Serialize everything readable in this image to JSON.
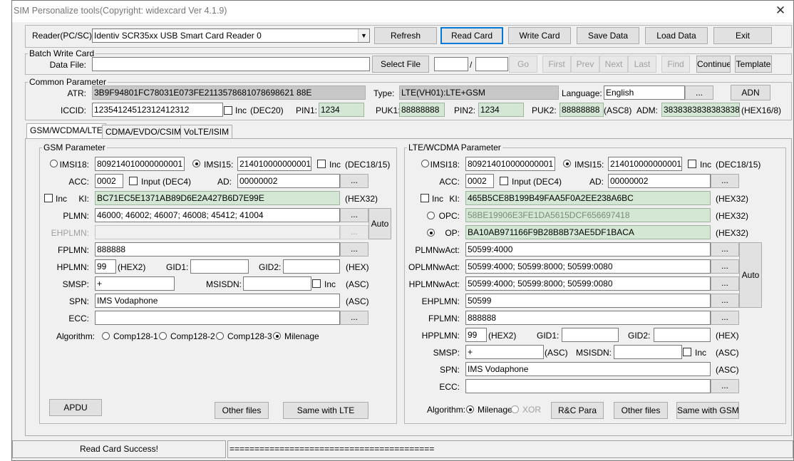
{
  "window": {
    "title": "SIM Personalize tools(Copyright: widexcard Ver 4.1.9)"
  },
  "reader": {
    "label": "Reader(PC/SC):",
    "value": "Identiv SCR35xx USB Smart Card Reader 0"
  },
  "toolbar": {
    "refresh": "Refresh",
    "read_card": "Read Card",
    "write_card": "Write Card",
    "save_data": "Save Data",
    "load_data": "Load Data",
    "exit": "Exit"
  },
  "batch": {
    "title": "Batch Write Card",
    "data_file_label": "Data File:",
    "data_file_value": "",
    "select_file": "Select File",
    "slash": "/",
    "go": "Go",
    "first": "First",
    "prev": "Prev",
    "next": "Next",
    "last": "Last",
    "find": "Find",
    "continue": "Continue",
    "template": "Template"
  },
  "common": {
    "title": "Common Parameter",
    "atr_label": "ATR:",
    "atr_value": "3B9F94801FC78031E073FE2113578681078698621 88E",
    "type_label": "Type:",
    "type_value": "LTE(VH01):LTE+GSM",
    "language_label": "Language:",
    "language_value": "English",
    "language_btn": "...",
    "adn_btn": "ADN",
    "iccid_label": "ICCID:",
    "iccid_value": "12354124512312412312",
    "inc_label": "Inc",
    "dec20": "(DEC20)",
    "pin1_label": "PIN1:",
    "pin1_value": "1234",
    "puk1_label": "PUK1:",
    "puk1_value": "88888888",
    "pin2_label": "PIN2:",
    "pin2_value": "1234",
    "puk2_label": "PUK2:",
    "puk2_value": "88888888",
    "asc8": "(ASC8)",
    "adm_label": "ADM:",
    "adm_value": "3838383838383838",
    "hex16_8": "(HEX16/8)"
  },
  "tabs": [
    "GSM/WCDMA/LTE",
    "CDMA/EVDO/CSIM",
    "VoLTE/ISIM"
  ],
  "gsm": {
    "title": "GSM Parameter",
    "imsi18_label": "IMSI18:",
    "imsi18_value": "809214010000000001",
    "imsi15_label": "IMSI15:",
    "imsi15_value": "214010000000001",
    "inc_label": "Inc",
    "dec18_15": "(DEC18/15)",
    "acc_label": "ACC:",
    "acc_value": "0002",
    "input_dec4": "Input (DEC4)",
    "ad_label": "AD:",
    "ad_value": "00000002",
    "ad_btn": "...",
    "ki_label": "KI:",
    "ki_value": "BC71EC5E1371AB89D6E2A427B6D7E99E",
    "hex32": "(HEX32)",
    "plmn_label": "PLMN:",
    "plmn_value": "46000; 46002; 46007; 46008; 45412; 41004",
    "ehplmn_label": "EHPLMN:",
    "ehplmn_value": "",
    "auto_btn": "Auto",
    "fplmn_label": "FPLMN:",
    "fplmn_value": "888888",
    "hplmn_label": "HPLMN:",
    "hplmn_value": "99",
    "hex2": "(HEX2)",
    "gid1_label": "GID1:",
    "gid1_value": "",
    "gid2_label": "GID2:",
    "gid2_value": "",
    "hex": "(HEX)",
    "smsp_label": "SMSP:",
    "smsp_value": "+",
    "msisdn_label": "MSISDN:",
    "msisdn_value": "",
    "asc": "(ASC)",
    "spn_label": "SPN:",
    "spn_value": "IMS Vodaphone",
    "ecc_label": "ECC:",
    "ecc_value": "",
    "algorithm_label": "Algorithm:",
    "comp128_1": "Comp128-1",
    "comp128_2": "Comp128-2",
    "comp128_3": "Comp128-3",
    "milenage": "Milenage",
    "apdu_btn": "APDU",
    "other_files_btn": "Other files",
    "same_lte_btn": "Same with LTE"
  },
  "lte": {
    "title": "LTE/WCDMA Parameter",
    "imsi18_label": "IMSI18:",
    "imsi18_value": "809214010000000001",
    "imsi15_label": "IMSI15:",
    "imsi15_value": "214010000000001",
    "inc_label": "Inc",
    "dec18_15": "(DEC18/15)",
    "acc_label": "ACC:",
    "acc_value": "0002",
    "input_dec4": "Input (DEC4)",
    "ad_label": "AD:",
    "ad_value": "00000002",
    "ki_label": "KI:",
    "ki_value": "465B5CE8B199B49FAA5F0A2EE238A6BC",
    "hex32": "(HEX32)",
    "opc_label": "OPC:",
    "opc_value": "58BE19906E3FE1DA5615DCF656697418",
    "op_label": "OP:",
    "op_value": "BA10AB971166F9B28B8B73AE5DF1BACA",
    "plmnwact_label": "PLMNwAct:",
    "plmnwact_value": "50599:4000",
    "oplmnwact_label": "OPLMNwAct:",
    "oplmnwact_value": "50599:4000; 50599:8000; 50599:0080",
    "hplmnwact_label": "HPLMNwAct:",
    "hplmnwact_value": "50599:4000; 50599:8000; 50599:0080",
    "ehplmn_label": "EHPLMN:",
    "ehplmn_value": "50599",
    "fplmn_label": "FPLMN:",
    "fplmn_value": "888888",
    "auto_btn": "Auto",
    "hpplmn_label": "HPPLMN:",
    "hpplmn_value": "99",
    "hex2": "(HEX2)",
    "gid1_label": "GID1:",
    "gid2_label": "GID2:",
    "hex": "(HEX)",
    "smsp_label": "SMSP:",
    "smsp_value": "+",
    "asc": "(ASC)",
    "msisdn_label": "MSISDN:",
    "msisdn_value": "",
    "spn_label": "SPN:",
    "spn_value": "IMS Vodaphone",
    "ecc_label": "ECC:",
    "ecc_value": "",
    "algorithm_label": "Algorithm:",
    "milenage": "Milenage",
    "xor": "XOR",
    "rc_para_btn": "R&C Para",
    "other_files_btn": "Other files",
    "same_gsm_btn": "Same with GSM"
  },
  "status": {
    "message": "Read Card Success!",
    "progress": "========================================="
  }
}
